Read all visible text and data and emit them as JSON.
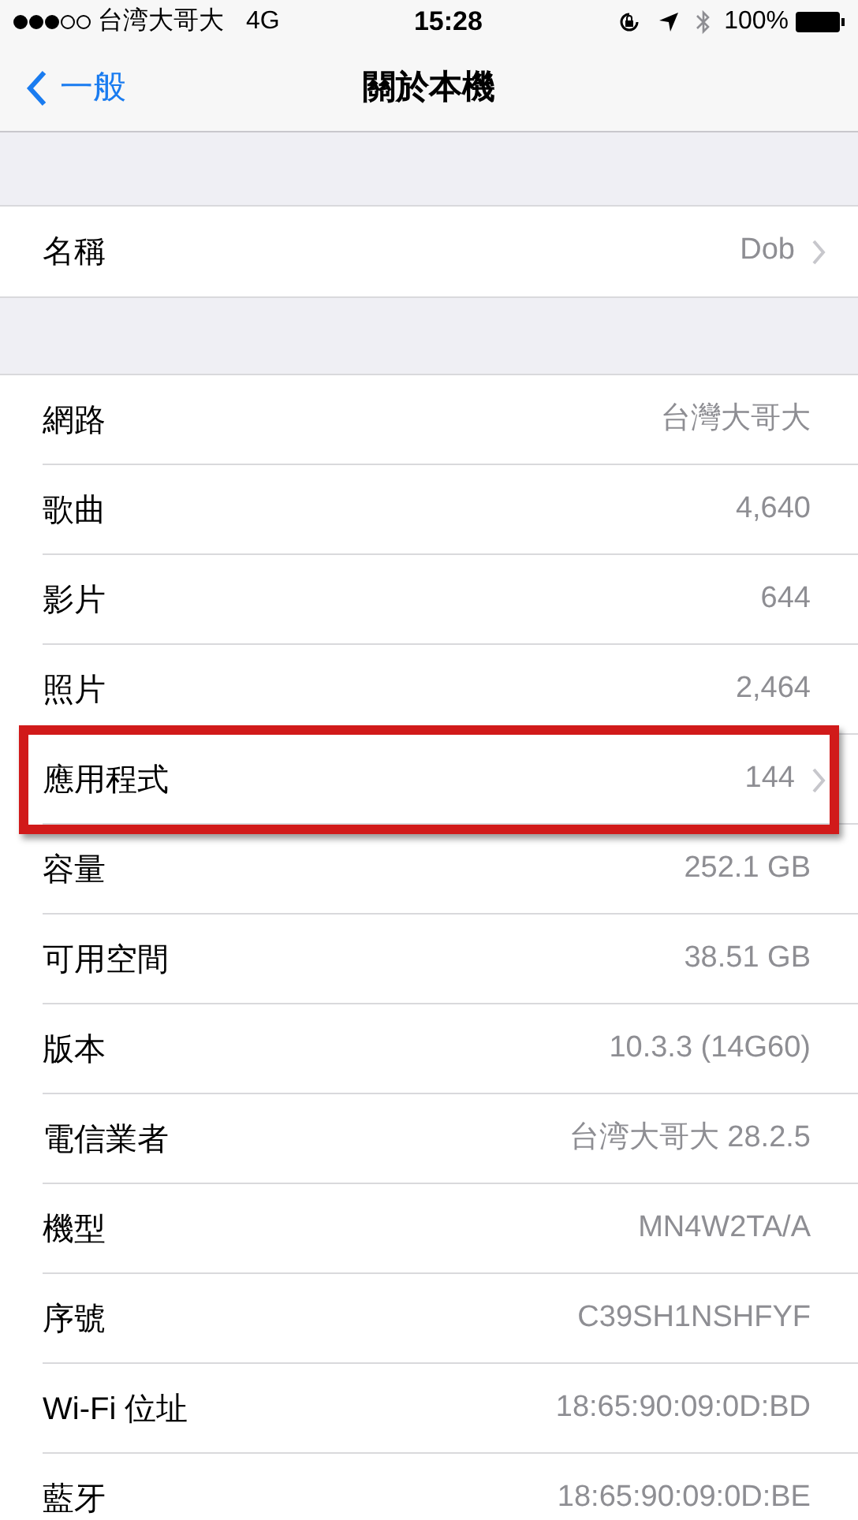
{
  "status_bar": {
    "carrier": "台湾大哥大",
    "network": "4G",
    "time": "15:28",
    "battery": "100%"
  },
  "nav": {
    "back": "一般",
    "title": "關於本機"
  },
  "groups": [
    {
      "rows": [
        {
          "label": "名稱",
          "value": "Dob",
          "chevron": true,
          "highlighted": false
        }
      ]
    },
    {
      "rows": [
        {
          "label": "網路",
          "value": "台灣大哥大",
          "chevron": false,
          "highlighted": false
        },
        {
          "label": "歌曲",
          "value": "4,640",
          "chevron": false,
          "highlighted": false
        },
        {
          "label": "影片",
          "value": "644",
          "chevron": false,
          "highlighted": false
        },
        {
          "label": "照片",
          "value": "2,464",
          "chevron": false,
          "highlighted": false
        },
        {
          "label": "應用程式",
          "value": "144",
          "chevron": true,
          "highlighted": true
        },
        {
          "label": "容量",
          "value": "252.1 GB",
          "chevron": false,
          "highlighted": false
        },
        {
          "label": "可用空間",
          "value": "38.51 GB",
          "chevron": false,
          "highlighted": false
        },
        {
          "label": "版本",
          "value": "10.3.3 (14G60)",
          "chevron": false,
          "highlighted": false
        },
        {
          "label": "電信業者",
          "value": "台湾大哥大 28.2.5",
          "chevron": false,
          "highlighted": false
        },
        {
          "label": "機型",
          "value": "MN4W2TA/A",
          "chevron": false,
          "highlighted": false
        },
        {
          "label": "序號",
          "value": "C39SH1NSHFYF",
          "chevron": false,
          "highlighted": false
        },
        {
          "label": "Wi-Fi 位址",
          "value": "18:65:90:09:0D:BD",
          "chevron": false,
          "highlighted": false
        },
        {
          "label": "藍牙",
          "value": "18:65:90:09:0D:BE",
          "chevron": false,
          "highlighted": false
        }
      ]
    }
  ]
}
